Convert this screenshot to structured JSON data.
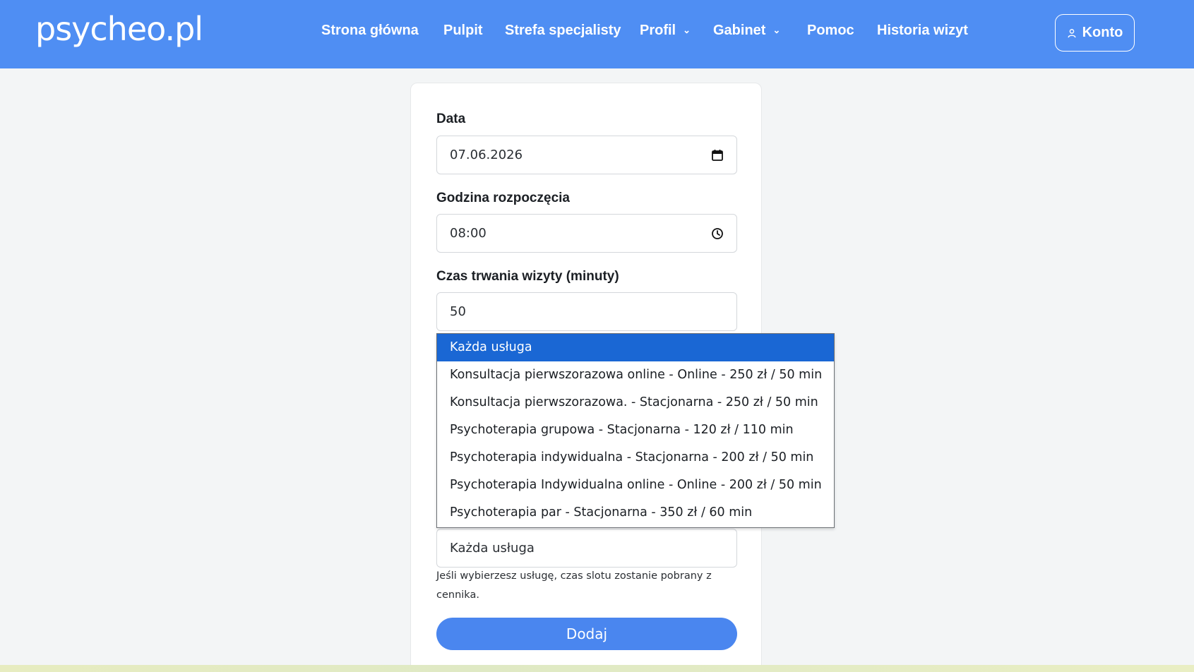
{
  "header": {
    "logo": "psycheo.pl",
    "nav": [
      {
        "label": "Strona główna",
        "has_dropdown": false
      },
      {
        "label": "Pulpit",
        "has_dropdown": false
      },
      {
        "label": "Strefa specjalisty",
        "has_dropdown": false
      },
      {
        "label": "Profil",
        "has_dropdown": true
      },
      {
        "label": "Gabinet",
        "has_dropdown": true
      },
      {
        "label": "Pomoc",
        "has_dropdown": false
      },
      {
        "label": "Historia wizyt",
        "has_dropdown": false
      }
    ],
    "account_label": "Konto",
    "account_icon": "user-icon",
    "chevron_icon": "chevron-down-icon"
  },
  "form": {
    "date": {
      "label": "Data",
      "value": "07.06.2026",
      "icon": "calendar-icon"
    },
    "start_time": {
      "label": "Godzina rozpoczęcia",
      "value": "08:00",
      "icon": "clock-icon"
    },
    "duration": {
      "label": "Czas trwania wizyty (minuty)",
      "value": "50"
    },
    "service": {
      "value": "Każda usługa",
      "hint": "Jeśli wybierzesz usługę, czas slotu zostanie pobrany z cennika.",
      "options": [
        "Każda usługa",
        "Konsultacja pierwszorazowa online - Online - 250 zł / 50 min",
        "Konsultacja pierwszorazowa. - Stacjonarna - 250 zł / 50 min",
        "Psychoterapia grupowa - Stacjonarna - 120 zł / 110 min",
        "Psychoterapia indywidualna - Stacjonarna - 200 zł / 50 min",
        "Psychoterapia Indywidualna online - Online - 200 zł / 50 min",
        "Psychoterapia par - Stacjonarna - 350 zł / 60 min"
      ],
      "selected_index": 0
    },
    "submit_label": "Dodaj"
  },
  "colors": {
    "header_bg": "#4f8ef3",
    "button_bg": "#4a86ef",
    "selected_option_bg": "#1a67d4",
    "page_bg": "#f3f5f6"
  }
}
